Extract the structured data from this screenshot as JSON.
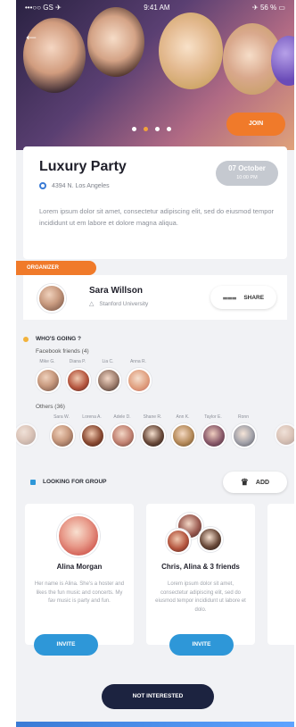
{
  "status_bar": {
    "left": "•••○○ GS ✈",
    "time": "9:41 AM",
    "right": "✈ 56 % ▭"
  },
  "event": {
    "join_label": "JOIN",
    "title": "Luxury Party",
    "location": "4394 N. Los Angeles",
    "date_line1": "07 October",
    "date_line2": "10:00 PM",
    "description": "Lorem ipsum dolor sit amet, consectetur adipiscing elit, sed do eiusmod tempor incididunt ut em labore et dolore magna aliqua."
  },
  "organizer": {
    "tag": "ORGANIZER",
    "name": "Sara Willson",
    "sub": "Stanford University",
    "share_label": "SHARE"
  },
  "going": {
    "title": "WHO'S GOING ?",
    "facebook_label": "Facebook friends (4)",
    "friends": [
      "Mike G.",
      "Diana P.",
      "Lia C.",
      "Anna R."
    ],
    "others_label": "Others (36)",
    "others": [
      "Sara W.",
      "Lorena A.",
      "Adele D.",
      "Shane R.",
      "Ann K.",
      "Taylor E.",
      "Ronn"
    ]
  },
  "looking": {
    "title": "LOOKING FOR GROUP",
    "add_label": "ADD"
  },
  "groups": [
    {
      "name": "Alina Morgan",
      "desc": "Her name is Alina. She's a hoster and likes the fun music and concerts. My fav music is party and fun.",
      "invite": "INVITE"
    },
    {
      "name": "Chris, Alina & 3 friends",
      "desc": "Lorem ipsum dolor sit amet, consectetur adipiscing elit, sed do eiusmod tempor incididunt ut labore et dolo.",
      "invite": "INVITE"
    }
  ],
  "footer": {
    "not_interested": "NOT INTERESTED"
  },
  "colors": {
    "accent_orange": "#f07a2a",
    "accent_blue": "#2e97d8",
    "dark_navy": "#1c2340",
    "dot_active": "#f2a23b"
  }
}
